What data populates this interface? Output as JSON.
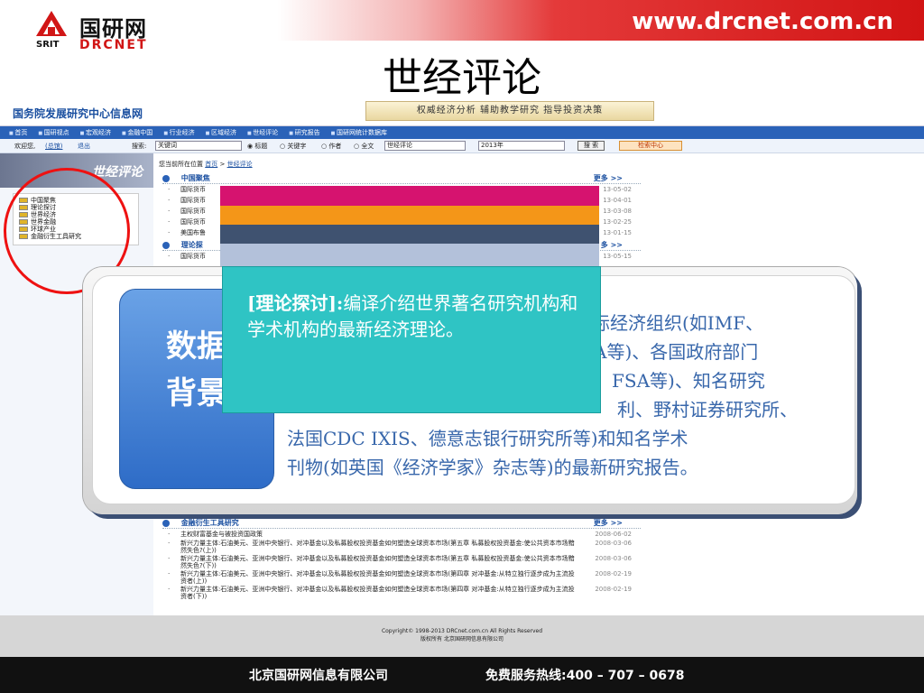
{
  "header": {
    "logo_cn": "国研网",
    "logo_srit": "SRIT",
    "logo_en": "DRCNET",
    "url": "www.drcnet.com.cn"
  },
  "slide_title": "世经评论",
  "website": {
    "site_title": "国务院发展研究中心信息网",
    "tagline": "权威经济分析   辅助教学研究   指导投资决策",
    "nav": [
      "首页",
      "国研视点",
      "宏观经济",
      "金融中国",
      "行业经济",
      "区域经济",
      "世经评论",
      "研究报告",
      "国研网统计数据库"
    ],
    "welcome": "欢迎您,",
    "user_link": "(总馆)",
    "logout": "退出",
    "search_label": "搜索:",
    "search_value": "关键词",
    "radio_options": [
      "标题",
      "关键字",
      "作者",
      "全文"
    ],
    "channel_select": "世经评论",
    "year_select": "2013年",
    "search_button": "搜 索",
    "search_center": "检索中心",
    "side_banner": "世经评论",
    "side_items": [
      "中国聚焦",
      "理论探讨",
      "世界经济",
      "世界金融",
      "环球产业",
      "金融衍生工具研究"
    ],
    "breadcrumb_prefix": "您当前所在位置",
    "breadcrumb_home": "首页",
    "breadcrumb_sep": ">",
    "breadcrumb_current": "世经评论",
    "sections": [
      {
        "title": "中国聚焦",
        "more": "更多 >>",
        "rows": [
          {
            "text": "国际货币",
            "date": "13-05-02"
          },
          {
            "text": "国际货币",
            "date": "13-04-01"
          },
          {
            "text": "国际货币",
            "date": "13-03-08"
          },
          {
            "text": "国际货币",
            "date": "13-02-25"
          },
          {
            "text": "美国布鲁",
            "date": "13-01-15"
          }
        ]
      },
      {
        "title": "理论探",
        "more": "多 >>",
        "rows": [
          {
            "text": "国际货币",
            "date": "13-05-15"
          }
        ]
      },
      {
        "title": "金融衍生工具研究",
        "more": "更多 >>",
        "rows": [
          {
            "text": "主权财富基金与被投资国政策",
            "date": "2008-06-02"
          },
          {
            "text": "新兴力量主体:石油美元、亚洲中央银行、对冲基金以及私募股权投资基金如何塑造全球资本市场(第五章 私募股权投资基金:使公共资本市场黯然失色?(上))",
            "date": "2008-03-06"
          },
          {
            "text": "新兴力量主体:石油美元、亚洲中央银行、对冲基金以及私募股权投资基金如何塑造全球资本市场(第五章 私募股权投资基金:使公共资本市场黯然失色?(下))",
            "date": "2008-03-06"
          },
          {
            "text": "新兴力量主体:石油美元、亚洲中央银行、对冲基金以及私募股权投资基金如何塑造全球资本市场(第四章 对冲基金:从特立独行逐步成为主流投资者(上))",
            "date": "2008-02-19"
          },
          {
            "text": "新兴力量主体:石油美元、亚洲中央银行、对冲基金以及私募股权投资基金如何塑造全球资本市场(第四章 对冲基金:从特立独行逐步成为主流投资者(下))",
            "date": "2008-02-19"
          }
        ]
      }
    ],
    "copyright_line1": "Copyright© 1998-2013 DRCnet.com.cn All Rights Reserved",
    "copyright_line2": "版权所有 北京国研网信息有限公司"
  },
  "callout": {
    "tab_line1": "数据",
    "tab_line2": "背景",
    "body_lines": [
      "际经济组织(如IMF、",
      "A等)、各国政府部门",
      "、FSA等)、知名研究",
      "利、野村证券研究所、",
      "法国CDC IXIS、德意志银行研究所等)和知名学术",
      "刊物(如英国《经济学家》杂志等)的最新研究报告。"
    ],
    "teal_heading": "[理论探讨]:",
    "teal_body": "编译介绍世界著名研究机构和学术机构的最新经济理论。"
  },
  "colors": {
    "bar_magenta": "#d6136f",
    "bar_orange": "#f49618",
    "bar_navy": "#3f5270",
    "bar_light": "#b3c1da",
    "teal": "#2fc4c4",
    "tab_blue": "#2e6cc7",
    "brand_red": "#d11616"
  },
  "footer": {
    "company": "北京国研网信息有限公司",
    "hotline": "免费服务热线:400 – 707 – 0678"
  }
}
